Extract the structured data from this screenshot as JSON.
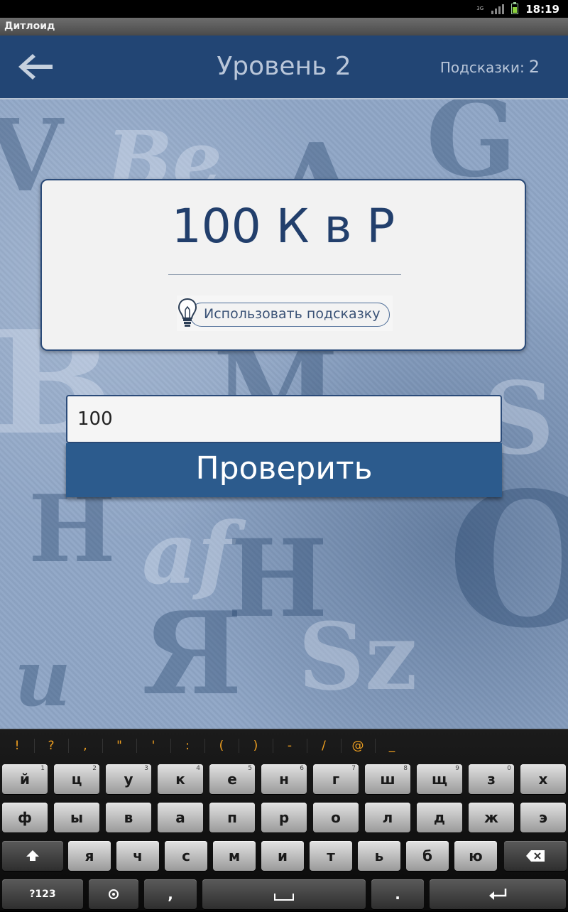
{
  "status_bar": {
    "time": "18:19",
    "network": "3G"
  },
  "window": {
    "title": "Дитлоид"
  },
  "header": {
    "title": "Уровень 2",
    "hints_label": "Подсказки:",
    "hints_count": "2"
  },
  "puzzle": {
    "text": "100 К в Р",
    "hint_button": "Использовать подсказку"
  },
  "answer": {
    "value": "100",
    "submit_label": "Проверить"
  },
  "keyboard": {
    "symbols": [
      "!",
      "?",
      ",",
      "\"",
      "'",
      ":",
      "(",
      ")",
      "-",
      "/",
      "@",
      "_"
    ],
    "row1": [
      {
        "k": "й",
        "n": "1"
      },
      {
        "k": "ц",
        "n": "2"
      },
      {
        "k": "у",
        "n": "3"
      },
      {
        "k": "к",
        "n": "4"
      },
      {
        "k": "е",
        "n": "5"
      },
      {
        "k": "н",
        "n": "6"
      },
      {
        "k": "г",
        "n": "7"
      },
      {
        "k": "ш",
        "n": "8"
      },
      {
        "k": "щ",
        "n": "9"
      },
      {
        "k": "з",
        "n": "0"
      },
      {
        "k": "х",
        "n": ""
      }
    ],
    "row2": [
      "ф",
      "ы",
      "в",
      "а",
      "п",
      "р",
      "о",
      "л",
      "д",
      "ж",
      "э"
    ],
    "row3": [
      "я",
      "ч",
      "с",
      "м",
      "и",
      "т",
      "ь",
      "б",
      "ю"
    ],
    "numeric_label": "?123",
    "comma": ",",
    "period": "."
  }
}
